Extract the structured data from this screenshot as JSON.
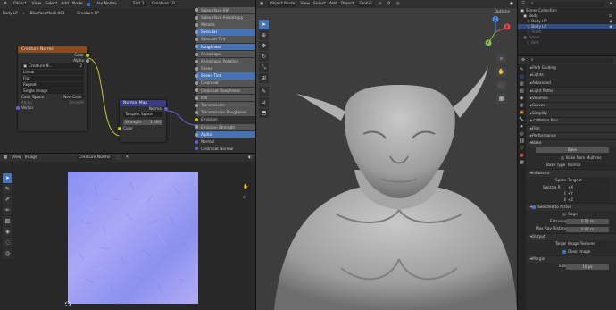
{
  "top_left_header": {
    "editor": "Object",
    "menus": [
      "View",
      "Select",
      "Add",
      "Node"
    ],
    "use_nodes": "Use Nodes",
    "slot": "Slot 1",
    "material": "Creature LP"
  },
  "node_breadcrumb": [
    "Body LP",
    "BSurfaceMesh.001",
    "Creature LP"
  ],
  "image_node": {
    "title": "Creature Norms",
    "image_name": "Creature N...",
    "image_users": "2",
    "outputs": [
      "Color",
      "Alpha"
    ],
    "interpolation": "Linear",
    "projection": "Flat",
    "extension": "Repeat",
    "source": "Single Image",
    "color_space_label": "Color Space",
    "color_space": "Non-Color",
    "alpha_label": "Alpha",
    "alpha_value": "Straight",
    "input": "Vector"
  },
  "normal_map_node": {
    "title": "Normal Map",
    "output": "Normal",
    "space": "Tangent Space",
    "strength_label": "Strength",
    "strength_value": "1.000",
    "input": "Color"
  },
  "bsdf_inputs": [
    {
      "label": "Subsurface IOR",
      "style": "slot"
    },
    {
      "label": "Subsurface Anisotropy",
      "style": "slot"
    },
    {
      "label": "Metallic",
      "style": "slot"
    },
    {
      "label": "Specular",
      "style": "blue"
    },
    {
      "label": "Specular Tint",
      "style": "slot"
    },
    {
      "label": "Roughness",
      "style": "blue"
    },
    {
      "label": "Anisotropic",
      "style": "slot"
    },
    {
      "label": "Anisotropic Rotation",
      "style": "slot"
    },
    {
      "label": "Sheen",
      "style": "slot"
    },
    {
      "label": "Sheen Tint",
      "style": "blue"
    },
    {
      "label": "Clearcoat",
      "style": "slot"
    },
    {
      "label": "Clearcoat Roughness",
      "style": "slot"
    },
    {
      "label": "IOR",
      "style": "slot"
    },
    {
      "label": "Transmission",
      "style": "slot"
    },
    {
      "label": "Transmission Roughness",
      "style": "slot"
    },
    {
      "label": "Emission",
      "style": "plain"
    },
    {
      "label": "Emission Strength",
      "style": "slot"
    },
    {
      "label": "Alpha",
      "style": "blue"
    },
    {
      "label": "Normal",
      "style": "plain"
    },
    {
      "label": "Clearcoat Normal",
      "style": "plain"
    },
    {
      "label": "Tangent",
      "style": "plain"
    }
  ],
  "image_editor": {
    "menus": [
      "View",
      "Image"
    ],
    "image_name": "Creature Norms"
  },
  "viewport_header": {
    "mode": "Object Mode",
    "menus": [
      "View",
      "Select",
      "Add",
      "Object"
    ],
    "orientation": "Global",
    "options": "Options"
  },
  "outliner": {
    "items": [
      {
        "label": "Scene Collection"
      },
      {
        "label": "Body"
      },
      {
        "label": "Body HP"
      },
      {
        "label": "Body LP"
      },
      {
        "label": "Teeth"
      },
      {
        "label": "Armor"
      },
      {
        "label": "Belt"
      }
    ]
  },
  "properties": {
    "panels": [
      "Path Guiding",
      "Lights",
      "Advanced",
      "Light Paths",
      "Volumes",
      "Curves",
      "Simplify",
      "Motion Blur",
      "Film",
      "Performance",
      "Bake"
    ],
    "bake_button": "Bake",
    "bake_multires": "Bake from Multires",
    "bake_type_label": "Bake Type",
    "bake_type": "Normal",
    "influence": "Influence",
    "space_label": "Space",
    "space": "Tangent",
    "swizzle_label": "Swizzle R",
    "swizzle_r": "+X",
    "g_label": "G",
    "swizzle_g": "+Y",
    "b_label": "B",
    "swizzle_b": "+Z",
    "selected_to_active": "Selected to Active",
    "cage": "Cage",
    "extrusion_label": "Extrusion",
    "extrusion": "0.01 m",
    "max_ray_label": "Max Ray Distance",
    "max_ray": "0.02 m",
    "output": "Output",
    "target_label": "Target",
    "target": "Image Textures",
    "clear_image": "Clear Image",
    "margin": "Margin",
    "size_label": "Size",
    "size": "16 px"
  },
  "colors": {
    "accent": "#4772b3",
    "texture_header": "#8a4a1c",
    "vector_header": "#3c3c83",
    "link_yellow": "#c7c729",
    "link_purple": "#6363c7"
  }
}
